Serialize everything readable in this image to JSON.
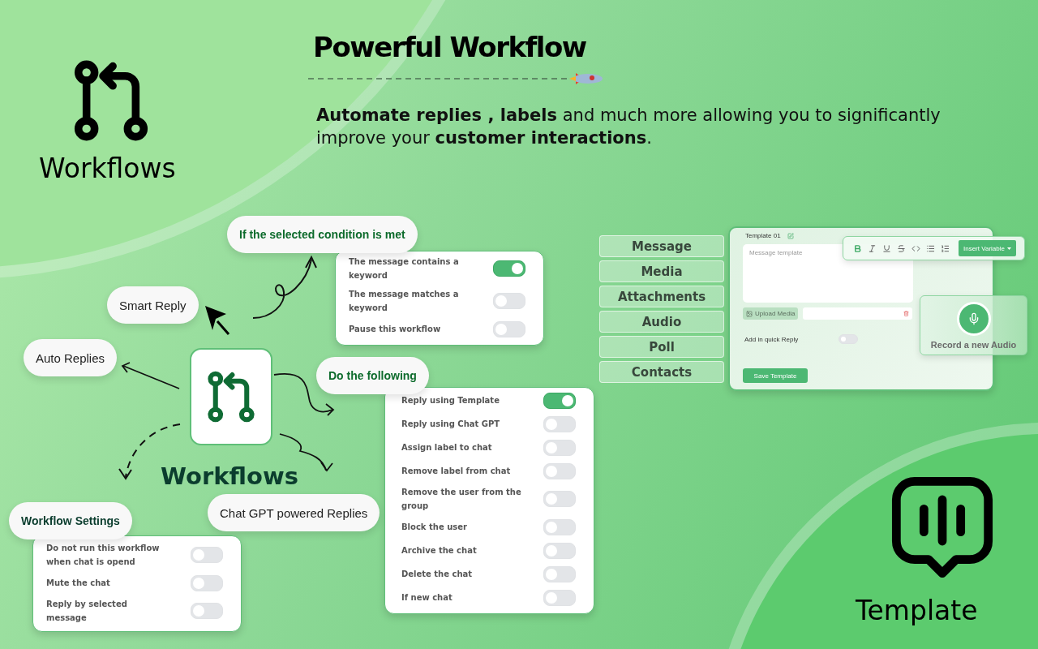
{
  "brand": {
    "title": "Workflows"
  },
  "hero": {
    "title": "Powerful Workflow",
    "description": "**Automate replies , labels** and much more allowing  you to significantly improve your **customer interactions**."
  },
  "feature_tags": [
    "Smart Reply",
    "Auto Replies",
    "Chat GPT powered Replies"
  ],
  "center_label": "Workflows",
  "condition_panel": {
    "heading": "If the selected condition is met",
    "options": [
      {
        "label": "The message contains a keyword",
        "on": true
      },
      {
        "label": "The message matches a keyword",
        "on": false
      },
      {
        "label": "Pause this workflow",
        "on": false
      }
    ]
  },
  "action_panel": {
    "heading": "Do the following",
    "options": [
      {
        "label": "Reply using Template",
        "on": true
      },
      {
        "label": "Reply using Chat GPT",
        "on": false
      },
      {
        "label": "Assign label to chat",
        "on": false
      },
      {
        "label": "Remove label from chat",
        "on": false
      },
      {
        "label": "Remove the user from the group",
        "on": false
      },
      {
        "label": "Block the user",
        "on": false
      },
      {
        "label": "Archive the chat",
        "on": false
      },
      {
        "label": "Delete the chat",
        "on": false
      },
      {
        "label": "If new chat",
        "on": false
      }
    ]
  },
  "settings_panel": {
    "heading": "Workflow Settings",
    "options": [
      {
        "label": "Do not run this workflow when chat is opend",
        "on": false
      },
      {
        "label": "Mute the chat",
        "on": false
      },
      {
        "label": "Reply by selected message",
        "on": false
      }
    ]
  },
  "template_editor": {
    "types": [
      "Message",
      "Media",
      "Attachments",
      "Audio",
      "Poll",
      "Contacts"
    ],
    "template_name": "Template 01",
    "message_placeholder": "Message template",
    "insert_button": "Insert Variable",
    "upload_button": "Upload Media",
    "quick_reply": {
      "label": "Add in quick Reply",
      "on": false
    },
    "save_button": "Save Template",
    "record_label": "Record a new Audio"
  },
  "footer_badge": {
    "title": "Template"
  }
}
